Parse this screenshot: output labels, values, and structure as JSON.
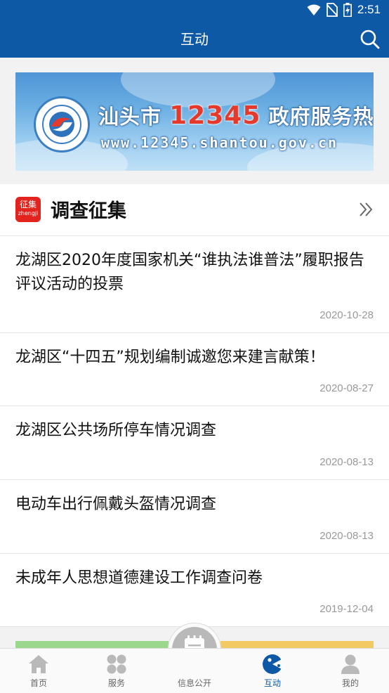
{
  "status_bar": {
    "time": "2:51"
  },
  "nav": {
    "title": "互动"
  },
  "banner": {
    "title_prefix": "汕头市",
    "hotline_number": "12345",
    "title_suffix": "政府服务热线",
    "url": "www.12345.shantou.gov.cn"
  },
  "section": {
    "icon_text": "征集",
    "icon_subtext": "zhengji",
    "title": "调查征集"
  },
  "items": [
    {
      "title": "龙湖区2020年度国家机关“谁执法谁普法”履职报告评议活动的投票",
      "date": "2020-10-28"
    },
    {
      "title": "龙湖区“十四五”规划编制诚邀您来建言献策！",
      "date": "2020-08-27"
    },
    {
      "title": "龙湖区公共场所停车情况调查",
      "date": "2020-08-13"
    },
    {
      "title": "电动车出行佩戴头盔情况调查",
      "date": "2020-08-13"
    },
    {
      "title": "未成年人思想道德建设工作调查问卷",
      "date": "2019-12-04"
    }
  ],
  "tabs": [
    {
      "label": "首页",
      "icon": "home-icon"
    },
    {
      "label": "服务",
      "icon": "services-icon"
    },
    {
      "label": "信息公开",
      "icon": "document-icon"
    },
    {
      "label": "互动",
      "icon": "interaction-icon",
      "active": true
    },
    {
      "label": "我的",
      "icon": "profile-icon"
    }
  ],
  "colors": {
    "primary": "#0d59a5",
    "accent_red": "#e3231e",
    "banner_number": "#e53a2b"
  }
}
